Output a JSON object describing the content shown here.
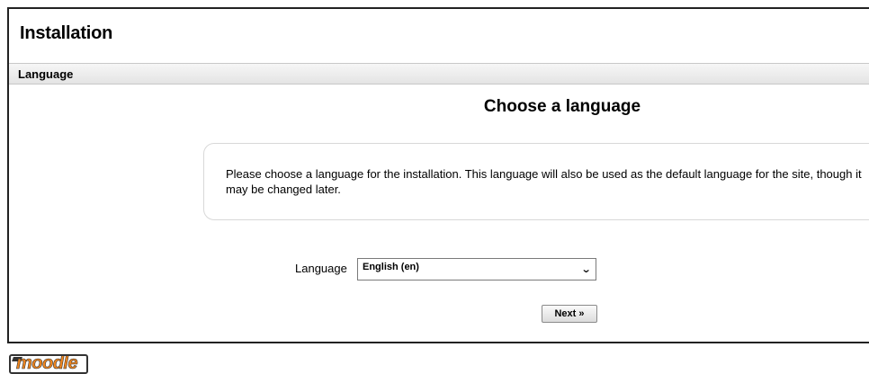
{
  "page": {
    "title": "Installation"
  },
  "section": {
    "label": "Language"
  },
  "main": {
    "heading": "Choose a language",
    "info_text": "Please choose a language for the installation. This language will also be used as the default language for the site, though it may be changed later."
  },
  "form": {
    "language_label": "Language",
    "language_selected": "English (en)",
    "next_label": "Next »"
  },
  "footer": {
    "logo_text": "moodle"
  },
  "colors": {
    "logo_orange": "#f0861e",
    "section_bar": "#eaeaea"
  }
}
